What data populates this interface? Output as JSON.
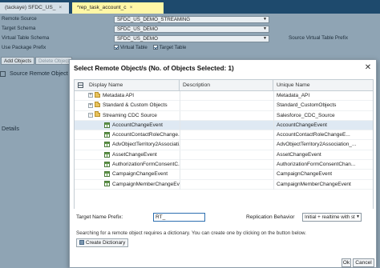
{
  "tabs": [
    {
      "label": "(tackaye) SFDC_US_",
      "close": "×"
    },
    {
      "label": "*rep_task_account_c",
      "close": "×"
    }
  ],
  "form": {
    "rows": [
      {
        "label": "Remote Source",
        "value": "SFDC_US_DEMO_STREAMING"
      },
      {
        "label": "Target Schema",
        "value": "SFDC_US_DEMO"
      },
      {
        "label": "Virtual Table Schema",
        "value": "SFDC_US_DEMO"
      },
      {
        "label": "Use Package Prefix",
        "value": ""
      }
    ],
    "source_prefix_label": "Source Virtual Table Prefix",
    "virtual_table_label": "Virtual Table",
    "target_table_label": "Target Table",
    "add_objects": "Add Objects",
    "delete_objects": "Delete Object",
    "source_remote_object": "Source Remote Object",
    "details": "Details"
  },
  "dialog": {
    "title": "Select Remote Object/s (No. of Objects Selected: 1)",
    "close": "✕",
    "columns": [
      "Display Name",
      "Description",
      "Unique Name"
    ],
    "rows": [
      {
        "level": 1,
        "type": "folder",
        "expander": "⊞",
        "name": "Metadata API",
        "desc": "",
        "unique": "Metadata_API",
        "selected": false
      },
      {
        "level": 1,
        "type": "folder",
        "expander": "⊞",
        "name": "Standard & Custom Objects",
        "desc": "",
        "unique": "Standard_CustomObjects",
        "selected": false
      },
      {
        "level": 1,
        "type": "folder",
        "expander": "⊟",
        "name": "Streaming CDC Source",
        "desc": "",
        "unique": "Salesforce_CDC_Source",
        "selected": false
      },
      {
        "level": 2,
        "type": "table",
        "name": "AccountChangeEvent",
        "desc": "",
        "unique": "AccountChangeEvent",
        "selected": true
      },
      {
        "level": 2,
        "type": "table",
        "name": "AccountContactRoleChange...",
        "desc": "",
        "unique": "AccountContactRoleChangeE...",
        "selected": false
      },
      {
        "level": 2,
        "type": "table",
        "name": "AdvObjectTerritory2Associati...",
        "desc": "",
        "unique": "AdvObjectTerritory2Association_...",
        "selected": false
      },
      {
        "level": 2,
        "type": "table",
        "name": "AssetChangeEvent",
        "desc": "",
        "unique": "AssetChangeEvent",
        "selected": false
      },
      {
        "level": 2,
        "type": "table",
        "name": "AuthorizationFormConsentC...",
        "desc": "",
        "unique": "AuthorizationFormConsentChan...",
        "selected": false
      },
      {
        "level": 2,
        "type": "table",
        "name": "CampaignChangeEvent",
        "desc": "",
        "unique": "CampaignChangeEvent",
        "selected": false
      },
      {
        "level": 2,
        "type": "table",
        "name": "CampaignMemberChangeEv...",
        "desc": "",
        "unique": "CampaignMemberChangeEvent",
        "selected": false
      }
    ],
    "target_prefix_label": "Target Name Prefix:",
    "target_prefix_value": "RT_",
    "replication_label": "Replication Behavior",
    "replication_value": "Initial + realtime with st",
    "hint": "Searching for a remote object requires a dictionary. You can create one by clicking on the button below.",
    "create_dictionary": "Create Dictionary",
    "ok": "Ok",
    "cancel": "Cancel"
  }
}
